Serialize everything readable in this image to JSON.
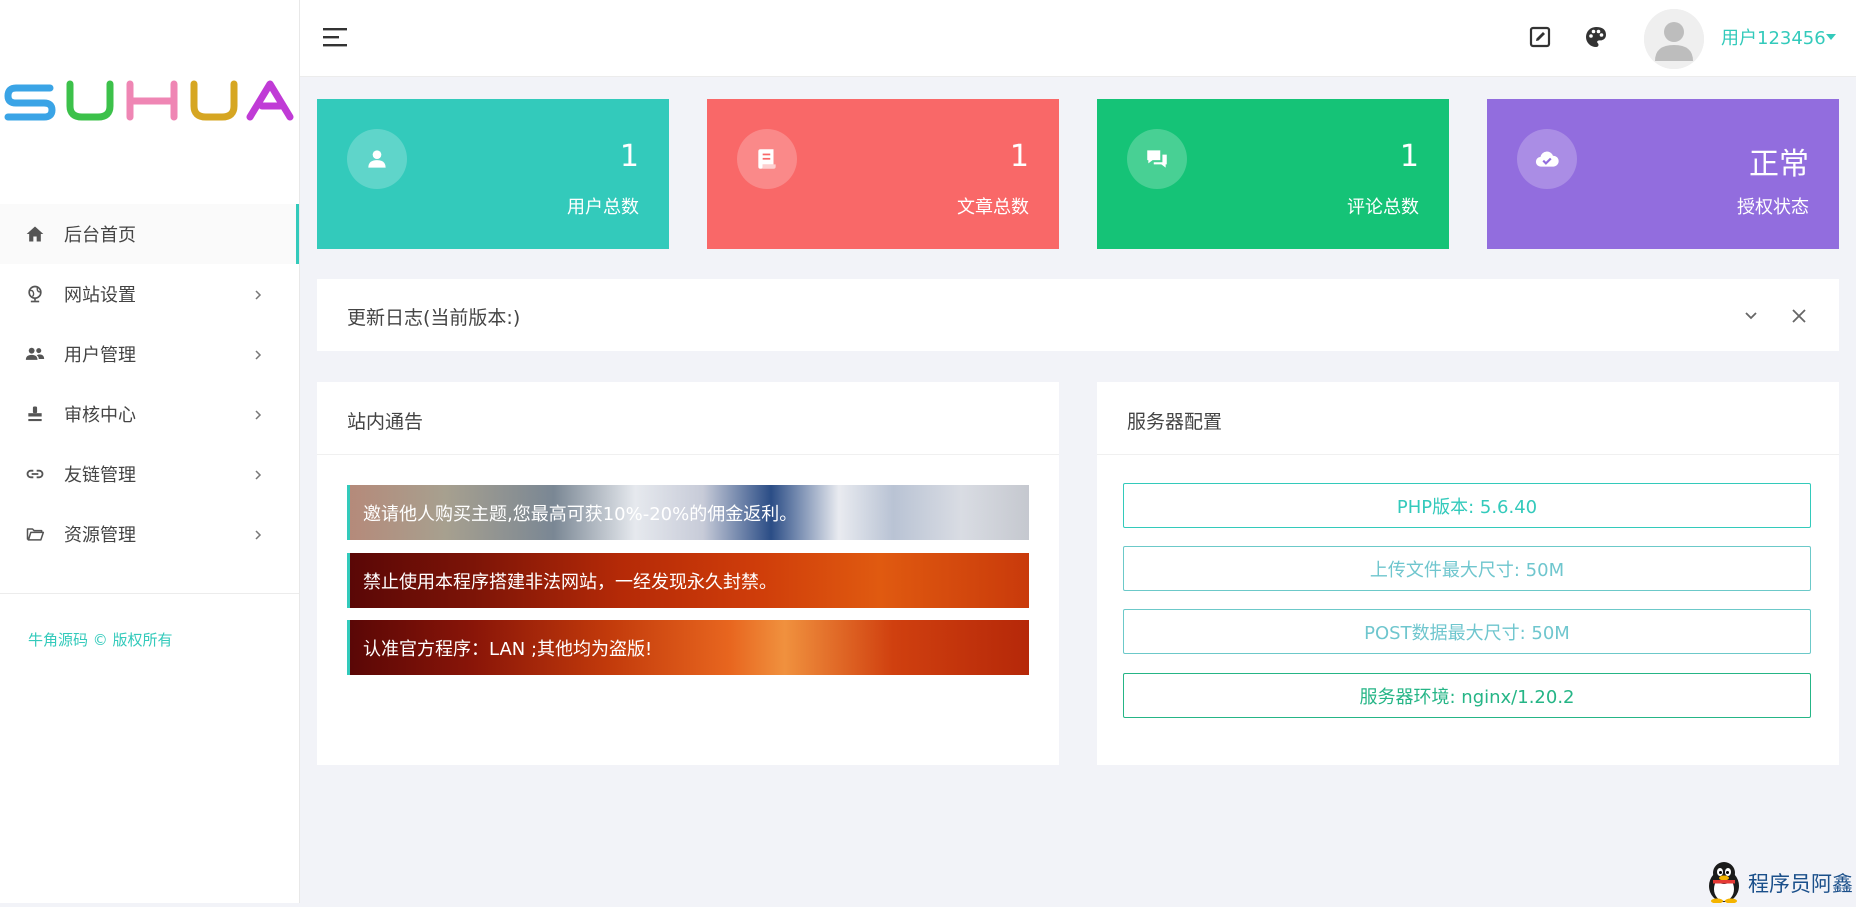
{
  "sidebar": {
    "brand": "SUHUA",
    "items": [
      {
        "label": "后台首页",
        "icon": "home-icon",
        "active": true
      },
      {
        "label": "网站设置",
        "icon": "globe-icon"
      },
      {
        "label": "用户管理",
        "icon": "users-icon"
      },
      {
        "label": "审核中心",
        "icon": "stamp-icon"
      },
      {
        "label": "友链管理",
        "icon": "link-icon"
      },
      {
        "label": "资源管理",
        "icon": "folder-icon"
      }
    ],
    "copyright": "牛角源码 © 版权所有"
  },
  "topbar": {
    "menu_icon": "hamburger-icon",
    "icons": [
      "edit-icon",
      "palette-icon"
    ],
    "username": "用户123456"
  },
  "stats": [
    {
      "value": "1",
      "label": "用户总数",
      "color": "#33cabb",
      "icon": "user-icon"
    },
    {
      "value": "1",
      "label": "文章总数",
      "color": "#f96868",
      "icon": "scroll-icon"
    },
    {
      "value": "1",
      "label": "评论总数",
      "color": "#15c377",
      "icon": "chat-icon"
    },
    {
      "value": "正常",
      "label": "授权状态",
      "color": "#926dde",
      "icon": "cloud-check-icon"
    }
  ],
  "changelog": {
    "title": "更新日志(当前版本:)"
  },
  "notices": {
    "title": "站内通告",
    "items": [
      "邀请他人购买主题,您最高可获10%-20%的佣金返利。",
      "禁止使用本程序搭建非法网站，一经发现永久封禁。",
      "认准官方程序：LAN ;其他均为盗版!"
    ]
  },
  "server": {
    "title": "服务器配置",
    "items": [
      "PHP版本: 5.6.40",
      "上传文件最大尺寸: 50M",
      "POST数据最大尺寸: 50M",
      "服务器环境: nginx/1.20.2"
    ]
  },
  "watermark": {
    "text": "程序员阿鑫"
  },
  "colors": {
    "accent": "#33cabb"
  }
}
